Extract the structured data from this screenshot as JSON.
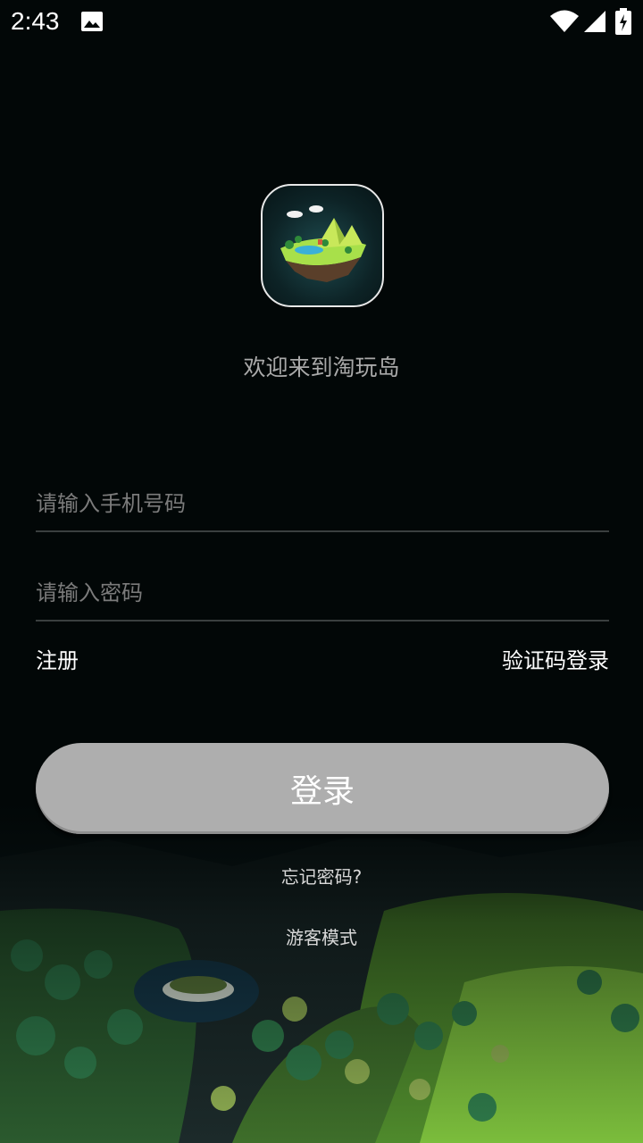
{
  "status_bar": {
    "time": "2:43",
    "icons": [
      "image-icon",
      "wifi-icon",
      "signal-icon",
      "battery-charging-icon"
    ]
  },
  "app": {
    "icon": "floating-island-logo",
    "welcome": "欢迎来到淘玩岛"
  },
  "form": {
    "phone_placeholder": "请输入手机号码",
    "password_placeholder": "请输入密码",
    "register_label": "注册",
    "sms_login_label": "验证码登录",
    "login_label": "登录",
    "forgot_label": "忘记密码?",
    "guest_label": "游客模式"
  },
  "colors": {
    "background": "#020707",
    "button": "#aeaeae",
    "placeholder": "#7b7b7b",
    "underline": "#3a3f3f"
  }
}
